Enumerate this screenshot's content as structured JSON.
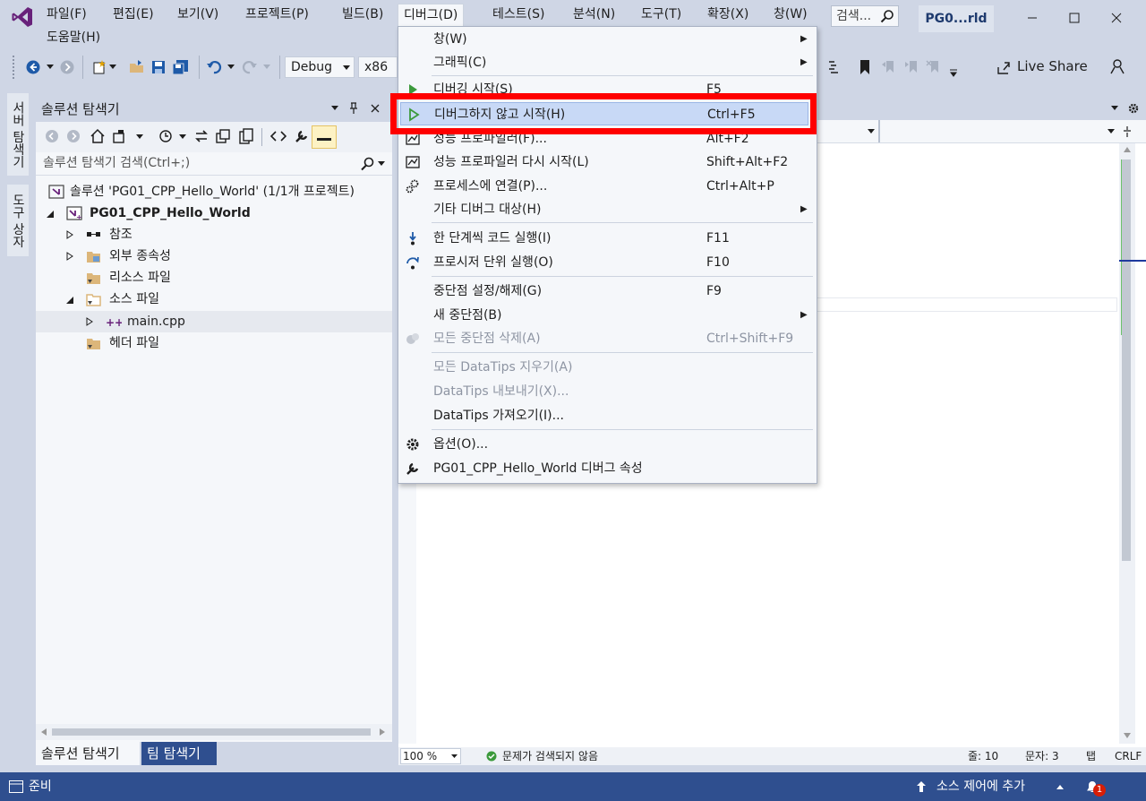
{
  "menu": {
    "file": "파일(F)",
    "edit": "편집(E)",
    "view": "보기(V)",
    "project": "프로젝트(P)",
    "build": "빌드(B)",
    "debug": "디버그(D)",
    "test": "테스트(S)",
    "analyze": "분석(N)",
    "tools": "도구(T)",
    "extensions": "확장(X)",
    "window": "창(W)",
    "help": "도움말(H)"
  },
  "search": {
    "label": "검색..."
  },
  "project_badge": "PG0...rld",
  "toolbar": {
    "config": "Debug",
    "platform": "x86",
    "live_share": "Live Share"
  },
  "side_tabs": {
    "server_explorer": "서버 탐색기",
    "toolbox": "도구 상자"
  },
  "solution_explorer": {
    "title": "솔루션 탐색기",
    "search_placeholder": "솔루션 탐색기 검색(Ctrl+;)",
    "tree": {
      "solution": "솔루션 'PG01_CPP_Hello_World' (1/1개 프로젝트)",
      "project": "PG01_CPP_Hello_World",
      "references": "참조",
      "external_deps": "외부 종속성",
      "resource_files": "리소스 파일",
      "source_files": "소스 파일",
      "main_cpp": "main.cpp",
      "header_files": "헤더 파일"
    },
    "bottom_tabs": {
      "solution_explorer": "솔루션 탐색기",
      "team_explorer": "팀 탐색기"
    }
  },
  "debug_menu": {
    "items": [
      {
        "label": "창(W)",
        "shortcut": "",
        "submenu": true
      },
      {
        "label": "그래픽(C)",
        "shortcut": "",
        "submenu": true
      },
      {
        "label": "디버깅 시작(S)",
        "shortcut": "F5"
      },
      {
        "label": "디버그하지 않고 시작(H)",
        "shortcut": "Ctrl+F5"
      },
      {
        "label": "성능 프로파일러(F)...",
        "shortcut": "Alt+F2"
      },
      {
        "label": "성능 프로파일러 다시 시작(L)",
        "shortcut": "Shift+Alt+F2"
      },
      {
        "label": "프로세스에 연결(P)...",
        "shortcut": "Ctrl+Alt+P"
      },
      {
        "label": "기타 디버그 대상(H)",
        "shortcut": "",
        "submenu": true
      },
      {
        "label": "한 단계씩 코드 실행(I)",
        "shortcut": "F11"
      },
      {
        "label": "프로시저 단위 실행(O)",
        "shortcut": "F10"
      },
      {
        "label": "중단점 설정/해제(G)",
        "shortcut": "F9"
      },
      {
        "label": "새 중단점(B)",
        "shortcut": "",
        "submenu": true
      },
      {
        "label": "모든 중단점 삭제(A)",
        "shortcut": "Ctrl+Shift+F9",
        "disabled": true
      },
      {
        "label": "모든 DataTips 지우기(A)",
        "shortcut": "",
        "disabled": true
      },
      {
        "label": "DataTips 내보내기(X)...",
        "shortcut": "",
        "disabled": true
      },
      {
        "label": "DataTips 가져오기(I)...",
        "shortcut": ""
      },
      {
        "label": "옵션(O)...",
        "shortcut": ""
      },
      {
        "label": "PG01_CPP_Hello_World 디버그 속성",
        "shortcut": ""
      }
    ],
    "highlighted_index": 3
  },
  "editor_status": {
    "zoom": "100 %",
    "issues": "문제가 검색되지 않음",
    "line": "줄: 10",
    "col": "문자: 3",
    "tab": "탭",
    "eol": "CRLF"
  },
  "status_bar": {
    "ready": "준비",
    "source_control": "소스 제어에 추가",
    "notification_count": "1"
  },
  "colors": {
    "accent": "#2f4f8f",
    "highlight_box": "#ff0000",
    "menu_hover": "#c8d9f6",
    "play_green": "#3c9a3c"
  }
}
